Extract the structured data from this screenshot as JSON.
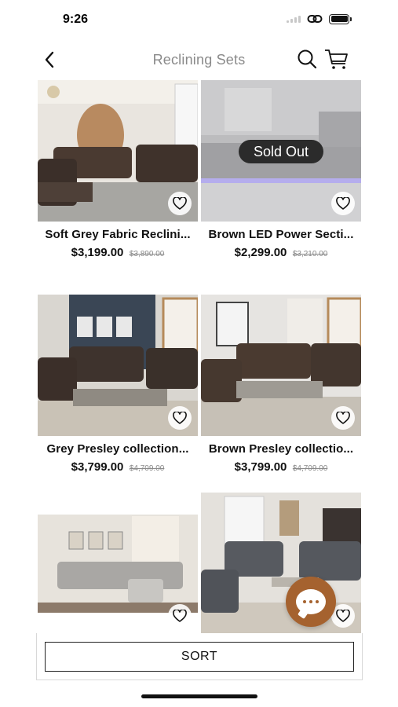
{
  "status_bar": {
    "time": "9:26"
  },
  "nav": {
    "title": "Reclining Sets"
  },
  "products": [
    {
      "name": "Soft Grey Fabric Reclini...",
      "price": "$3,199.00",
      "old_price": "$3,890.00",
      "sold_out": false
    },
    {
      "name": "Brown LED Power Secti...",
      "price": "$2,299.00",
      "old_price": "$3,210.00",
      "sold_out": true,
      "badge": "Sold Out"
    },
    {
      "name": "Grey Presley collection...",
      "price": "$3,799.00",
      "old_price": "$4,709.00",
      "sold_out": false
    },
    {
      "name": "Brown Presley collectio...",
      "price": "$3,799.00",
      "old_price": "$4,709.00",
      "sold_out": false
    },
    {
      "name": "",
      "price": "",
      "old_price": "",
      "sold_out": false
    },
    {
      "name": "",
      "price": "",
      "old_price": "",
      "sold_out": false
    }
  ],
  "sort": {
    "label": "SORT"
  },
  "colors": {
    "accent": "#a5622f",
    "title_gray": "#8a8a8a",
    "sold_badge": "#2b2b2b"
  },
  "icons": [
    "back-icon",
    "search-icon",
    "cart-icon",
    "heart-icon",
    "chat-icon",
    "battery-icon",
    "signal-icon",
    "link-icon"
  ]
}
